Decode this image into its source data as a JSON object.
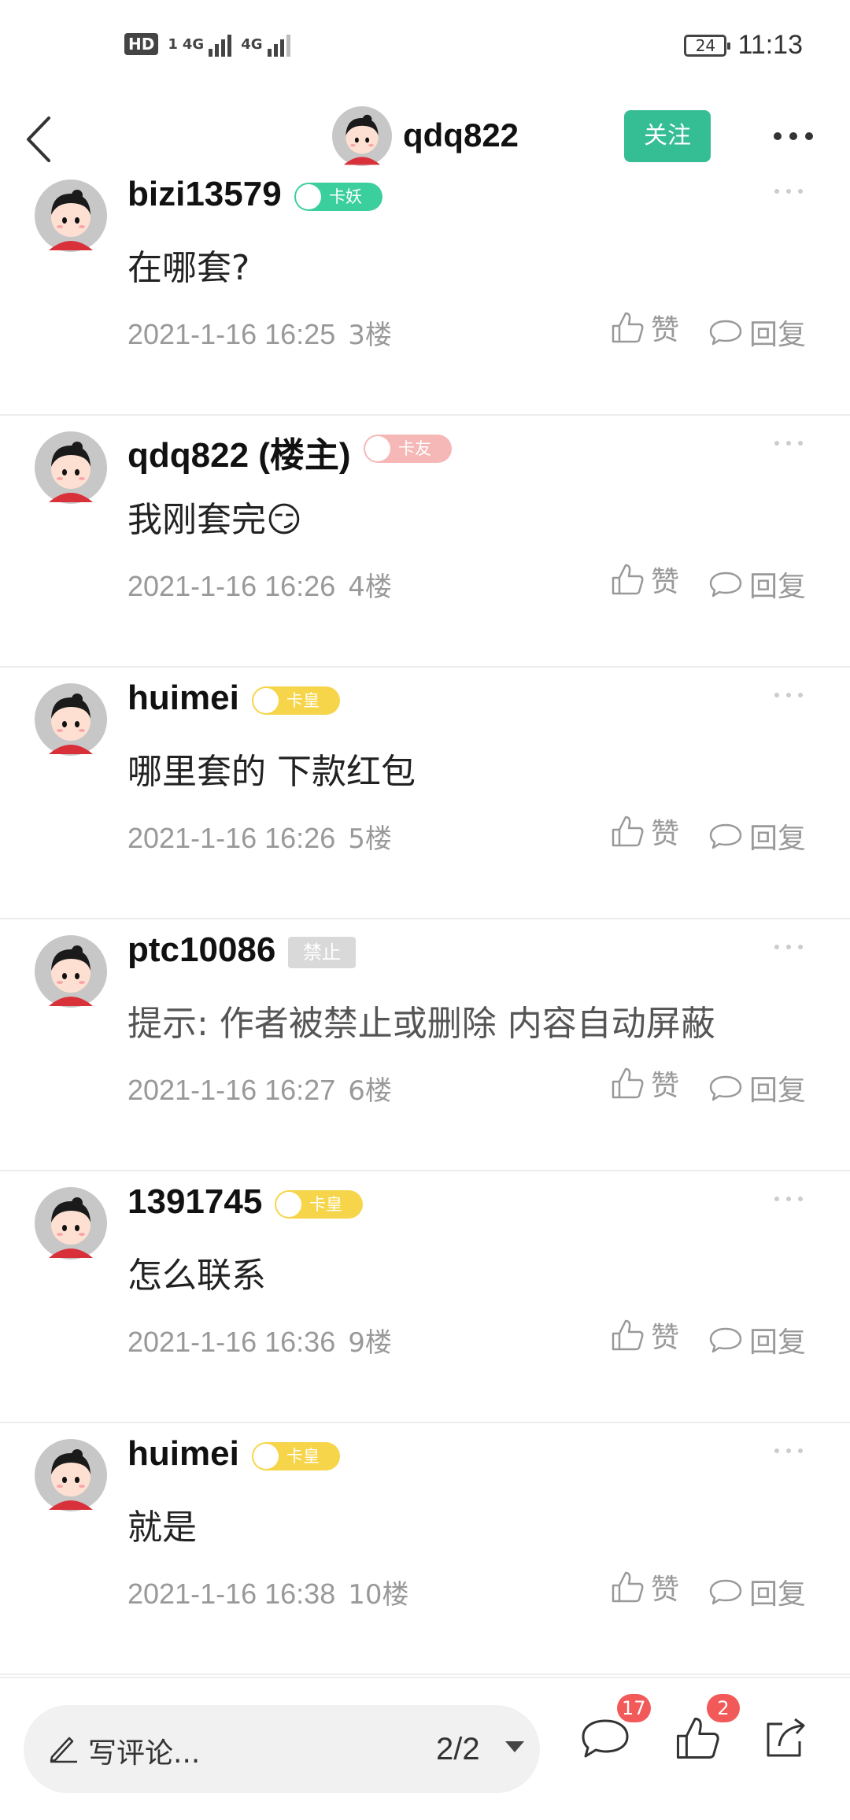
{
  "status_bar": {
    "hd_label": "HD",
    "sim1_label": "1",
    "network_1": "4G",
    "network_2": "4G",
    "battery_level": "24",
    "time": "11:13"
  },
  "header": {
    "username": "qdq822",
    "follow_label": "关注"
  },
  "comments": [
    {
      "username": "bizi13579",
      "badge": "卡妖",
      "badge_color": "#3ccf9e",
      "text": "在哪套?",
      "time": "2021-1-16 16:25",
      "floor": "3楼",
      "like_label": "赞",
      "reply_label": "回复"
    },
    {
      "username": "qdq822 (楼主)",
      "badge": "卡友",
      "badge_color": "#f6b7b7",
      "text": "我刚套完",
      "emoji": "😏",
      "time": "2021-1-16 16:26",
      "floor": "4楼",
      "like_label": "赞",
      "reply_label": "回复"
    },
    {
      "username": "huimei",
      "badge": "卡皇",
      "badge_color": "#f7d54a",
      "text": "哪里套的 下款红包",
      "time": "2021-1-16 16:26",
      "floor": "5楼",
      "like_label": "赞",
      "reply_label": "回复"
    },
    {
      "username": "ptc10086",
      "badge": "禁止",
      "badge_color": "#d9d9d9",
      "text": "提示: 作者被禁止或删除 内容自动屏蔽",
      "time": "2021-1-16 16:27",
      "floor": "6楼",
      "like_label": "赞",
      "reply_label": "回复"
    },
    {
      "username": "1391745",
      "badge": "卡皇",
      "badge_color": "#f7d54a",
      "text": "怎么联系",
      "time": "2021-1-16 16:36",
      "floor": "9楼",
      "like_label": "赞",
      "reply_label": "回复"
    },
    {
      "username": "huimei",
      "badge": "卡皇",
      "badge_color": "#f7d54a",
      "text": "就是",
      "time": "2021-1-16 16:38",
      "floor": "10楼",
      "like_label": "赞",
      "reply_label": "回复"
    }
  ],
  "bottom_bar": {
    "comment_placeholder": "写评论...",
    "page_indicator": "2/2",
    "comment_count": "17",
    "like_count": "2"
  },
  "colors": {
    "accent": "#35bd93",
    "badge_red": "#f25a5a"
  }
}
